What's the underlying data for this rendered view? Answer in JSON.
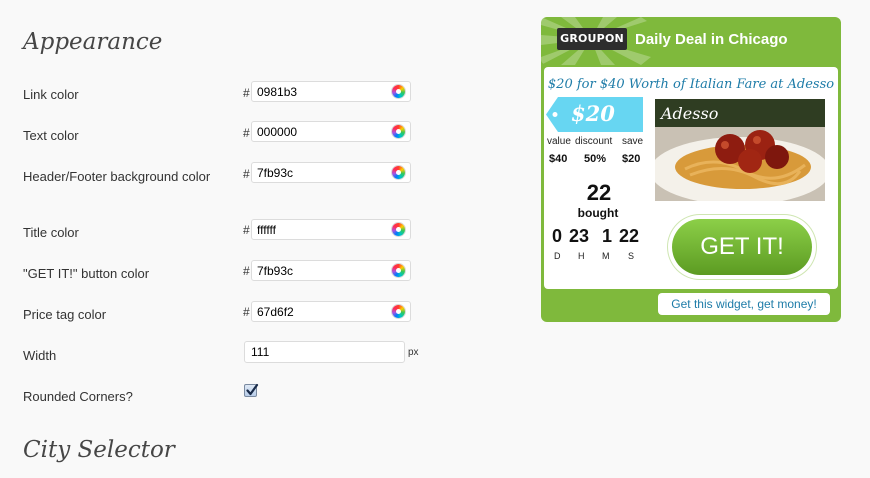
{
  "appearance": {
    "heading": "Appearance",
    "link_color": {
      "label": "Link color",
      "hash": "#",
      "value": "0981b3"
    },
    "text_color": {
      "label": "Text color",
      "hash": "#",
      "value": "000000"
    },
    "header_footer_bg": {
      "label": "Header/Footer background color",
      "hash": "#",
      "value": "7fb93c"
    },
    "title_color": {
      "label": "Title color",
      "hash": "#",
      "value": "ffffff"
    },
    "button_color": {
      "label": "\"GET IT!\" button color",
      "hash": "#",
      "value": "7fb93c"
    },
    "price_tag_color": {
      "label": "Price tag color",
      "hash": "#",
      "value": "67d6f2"
    },
    "width": {
      "label": "Width",
      "value": "111",
      "unit": "px"
    },
    "rounded_corners": {
      "label": "Rounded Corners?",
      "checked": true
    }
  },
  "city_selector": {
    "heading": "City Selector"
  },
  "widget": {
    "logo": "GROUPON",
    "title": "Daily Deal in Chicago",
    "deal_title": "$20 for $40 Worth of Italian Fare at Adesso",
    "price": "$20",
    "value_label": "value",
    "discount_label": "discount",
    "save_label": "save",
    "value": "$40",
    "discount": "50%",
    "save": "$20",
    "bought_count": "22",
    "bought_label": "bought",
    "countdown": {
      "d": "0",
      "h": "23",
      "m": "1",
      "s": "22"
    },
    "countdown_labels": {
      "d": "D",
      "h": "H",
      "m": "M",
      "s": "S"
    },
    "restaurant_logo": "Adesso",
    "cta": "GET IT!",
    "footer_link": "Get this widget, get money!",
    "colors": {
      "frame": "#7fb93c",
      "price_tag": "#67d6f2",
      "link": "#0981b3"
    }
  }
}
